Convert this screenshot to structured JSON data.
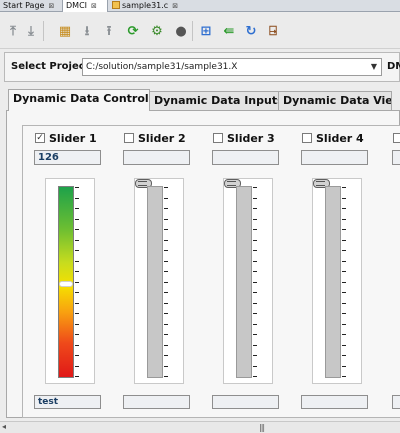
{
  "editor_tabs": [
    {
      "label": "Start Page",
      "close": "⊠"
    },
    {
      "label": "DMCI",
      "close": "⊠"
    },
    {
      "label": "sample31.c",
      "close": "⊠"
    }
  ],
  "toolbar": {
    "icons": [
      "move-top-icon",
      "move-bottom-icon",
      "table-grid-icon",
      "download-icon",
      "upload-icon",
      "refresh-icon",
      "settings-clock-icon",
      "record-icon",
      "layout-icon",
      "import-icon",
      "reload-icon",
      "exit-door-icon"
    ]
  },
  "project": {
    "label": "Select Project",
    "value": "C:/solution/sample31/sample31.X",
    "dmc_label": "DMC"
  },
  "inner_tabs": [
    "Dynamic Data Controls",
    "Dynamic Data Inputs",
    "Dynamic Data View"
  ],
  "sliders": [
    {
      "label": "Slider 1",
      "checked": true,
      "value": "126",
      "name": "test",
      "level_fraction": 0.49
    },
    {
      "label": "Slider 2",
      "checked": false,
      "value": "",
      "name": "",
      "level_fraction": 0
    },
    {
      "label": "Slider 3",
      "checked": false,
      "value": "",
      "name": "",
      "level_fraction": 0
    },
    {
      "label": "Slider 4",
      "checked": false,
      "value": "",
      "name": "",
      "level_fraction": 0
    }
  ],
  "check_mark": "✓",
  "scrollbar": {
    "grip": "|||",
    "left_arrow": "◂"
  },
  "colors": {
    "gradient_top": "#1ea24a",
    "gradient_mid": "#f6e000",
    "gradient_bottom": "#e01818",
    "value_text": "#1b3e63"
  }
}
